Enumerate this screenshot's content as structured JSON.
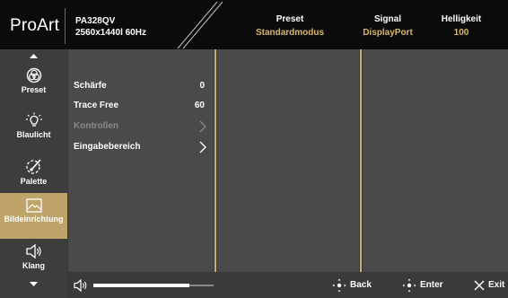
{
  "header": {
    "brand": "ProArt",
    "model": "PA328QV",
    "resolution": "2560x1440",
    "refresh": "60Hz",
    "preset_label": "Preset",
    "preset_value": "Standardmodus",
    "signal_label": "Signal",
    "signal_value": "DisplayPort",
    "brightness_label": "Helligkeit",
    "brightness_value": "100"
  },
  "sidebar": {
    "items": [
      {
        "label": "Preset",
        "icon": "preset-icon"
      },
      {
        "label": "Blaulicht",
        "icon": "blue-light-icon"
      },
      {
        "label": "Palette",
        "icon": "palette-icon"
      },
      {
        "label": "Bildeinrichtung",
        "icon": "image-setup-icon",
        "active": true
      },
      {
        "label": "Klang",
        "icon": "speaker-icon"
      }
    ]
  },
  "menu": {
    "items": [
      {
        "label": "Schärfe",
        "value": "0"
      },
      {
        "label": "Trace Free",
        "value": "60"
      },
      {
        "label": "Kontrollen",
        "disabled": true
      },
      {
        "label": "Eingabebereich"
      }
    ]
  },
  "footer": {
    "volume_level": 0.8,
    "back_label": "Back",
    "enter_label": "Enter",
    "exit_label": "Exit"
  },
  "colors": {
    "accent": "#bfa46a",
    "header_value": "#d9b76a",
    "header_bg": "#0b0b0b",
    "panel_bg": "#4a4a4a"
  }
}
